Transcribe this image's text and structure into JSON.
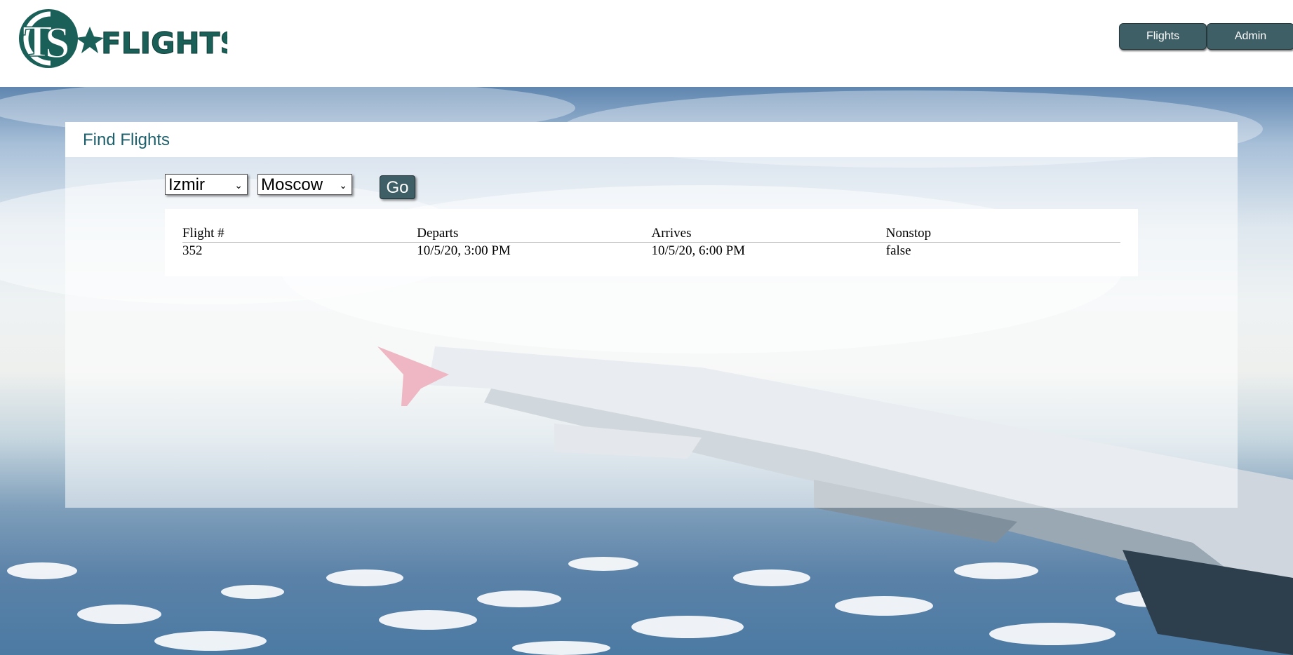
{
  "header": {
    "logo_text": "FLIGHTS",
    "logo_initials": "TS",
    "nav": [
      {
        "label": "Flights"
      },
      {
        "label": "Admin"
      }
    ]
  },
  "search": {
    "title": "Find Flights",
    "from_value": "Izmir",
    "to_value": "Moscow",
    "go_label": "Go"
  },
  "results": {
    "columns": [
      "Flight #",
      "Departs",
      "Arrives",
      "Nonstop"
    ],
    "rows": [
      [
        "352",
        "10/5/20, 3:00 PM",
        "10/5/20, 6:00 PM",
        "false"
      ]
    ]
  },
  "colors": {
    "brand": "#1a5f58",
    "button": "#3e5f66",
    "title": "#1d5f6b"
  }
}
